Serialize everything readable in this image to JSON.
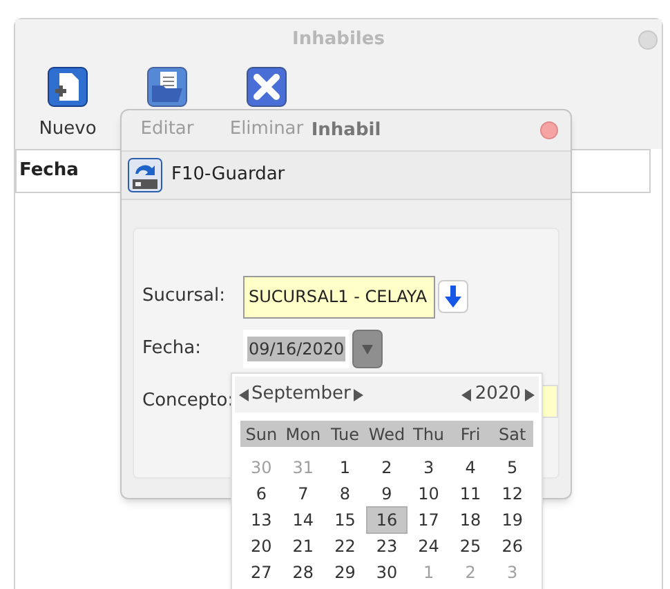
{
  "main_window": {
    "title": "Inhabiles",
    "toolbar": [
      {
        "label": "Nuevo",
        "kind": "new",
        "disabled": false
      },
      {
        "label": "Editar",
        "kind": "edit",
        "disabled": true
      },
      {
        "label": "Eliminar",
        "kind": "delete",
        "disabled": true
      }
    ],
    "table": {
      "columns": [
        "Fecha"
      ]
    }
  },
  "dialog": {
    "title": "Inhabil",
    "save_button": "F10-Guardar",
    "fields": [
      {
        "label": "Sucursal:",
        "kind": "lookup",
        "value": "SUCURSAL1 - CELAYA"
      },
      {
        "label": "Fecha:",
        "kind": "date",
        "value": "09/16/2020"
      },
      {
        "label": "Concepto:",
        "kind": "text"
      }
    ]
  },
  "calendar": {
    "month": "September",
    "year": "2020",
    "weekdays": [
      "Sun",
      "Mon",
      "Tue",
      "Wed",
      "Thu",
      "Fri",
      "Sat"
    ],
    "weeks": [
      [
        {
          "label": "30",
          "muted": true,
          "selected": false
        },
        {
          "label": "31",
          "muted": true,
          "selected": false
        },
        {
          "label": "1",
          "muted": false,
          "selected": false
        },
        {
          "label": "2",
          "muted": false,
          "selected": false
        },
        {
          "label": "3",
          "muted": false,
          "selected": false
        },
        {
          "label": "4",
          "muted": false,
          "selected": false
        },
        {
          "label": "5",
          "muted": false,
          "selected": false
        }
      ],
      [
        {
          "label": "6",
          "muted": false,
          "selected": false
        },
        {
          "label": "7",
          "muted": false,
          "selected": false
        },
        {
          "label": "8",
          "muted": false,
          "selected": false
        },
        {
          "label": "9",
          "muted": false,
          "selected": false
        },
        {
          "label": "10",
          "muted": false,
          "selected": false
        },
        {
          "label": "11",
          "muted": false,
          "selected": false
        },
        {
          "label": "12",
          "muted": false,
          "selected": false
        }
      ],
      [
        {
          "label": "13",
          "muted": false,
          "selected": false
        },
        {
          "label": "14",
          "muted": false,
          "selected": false
        },
        {
          "label": "15",
          "muted": false,
          "selected": false
        },
        {
          "label": "16",
          "muted": false,
          "selected": true
        },
        {
          "label": "17",
          "muted": false,
          "selected": false
        },
        {
          "label": "18",
          "muted": false,
          "selected": false
        },
        {
          "label": "19",
          "muted": false,
          "selected": false
        }
      ],
      [
        {
          "label": "20",
          "muted": false,
          "selected": false
        },
        {
          "label": "21",
          "muted": false,
          "selected": false
        },
        {
          "label": "22",
          "muted": false,
          "selected": false
        },
        {
          "label": "23",
          "muted": false,
          "selected": false
        },
        {
          "label": "24",
          "muted": false,
          "selected": false
        },
        {
          "label": "25",
          "muted": false,
          "selected": false
        },
        {
          "label": "26",
          "muted": false,
          "selected": false
        }
      ],
      [
        {
          "label": "27",
          "muted": false,
          "selected": false
        },
        {
          "label": "28",
          "muted": false,
          "selected": false
        },
        {
          "label": "29",
          "muted": false,
          "selected": false
        },
        {
          "label": "30",
          "muted": false,
          "selected": false
        },
        {
          "label": "1",
          "muted": true,
          "selected": false
        },
        {
          "label": "2",
          "muted": true,
          "selected": false
        },
        {
          "label": "3",
          "muted": true,
          "selected": false
        }
      ]
    ]
  }
}
